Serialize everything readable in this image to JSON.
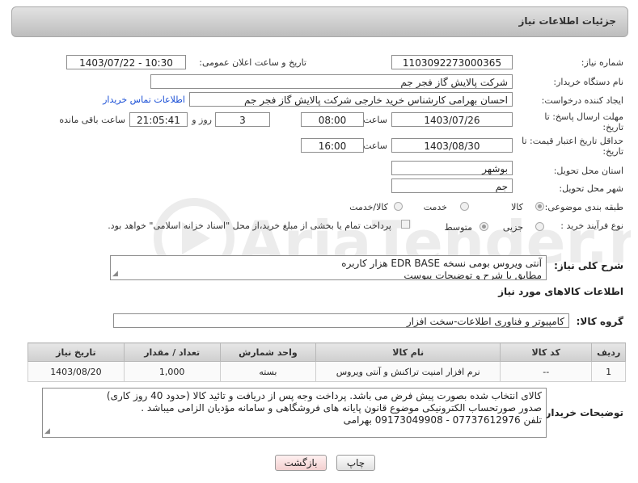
{
  "header": {
    "title": "جزئیات اطلاعات نیاز"
  },
  "form": {
    "need_number_label": "شماره نیاز:",
    "need_number": "1103092273000365",
    "announce_label": "تاریخ و ساعت اعلان عمومی:",
    "announce_value": "1403/07/22 - 10:30",
    "buyer_org_label": "نام دستگاه خریدار:",
    "buyer_org": "شرکت پالایش گاز فجر جم",
    "creator_label": "ایجاد کننده درخواست:",
    "creator": "احسان بهرامی کارشناس خرید خارجی شرکت پالایش گاز فجر جم",
    "contact_link": "اطلاعات تماس خریدار",
    "deadline_label_1": "مهلت ارسال پاسخ: تا",
    "deadline_label_2": "تاریخ:",
    "deadline_date": "1403/07/26",
    "time_label": "ساعت",
    "deadline_time": "08:00",
    "days_value": "3",
    "days_label": "روز و",
    "remaining_time": "21:05:41",
    "remaining_label": "ساعت باقی مانده",
    "validity_label_1": "حداقل تاریخ اعتبار قیمت: تا",
    "validity_label_2": "تاریخ:",
    "validity_date": "1403/08/30",
    "validity_time": "16:00",
    "province_label": "استان محل تحویل:",
    "province": "بوشهر",
    "city_label": "شهر محل تحویل:",
    "city": "جم",
    "category_label": "طبقه بندی موضوعی:",
    "category_options": [
      "کالا",
      "خدمت",
      "کالا/خدمت"
    ],
    "process_label": "نوع فرآیند خرید :",
    "process_options": [
      "جزیی",
      "متوسط"
    ],
    "payment_note": "پرداخت تمام یا بخشی از مبلغ خرید،از محل \"اسناد خزانه اسلامی\" خواهد بود."
  },
  "description": {
    "label": "شرح کلی نیاز:",
    "line1": "آنتی ویروس بومی نسخه EDR BASE  هزار کاربره",
    "line2": "مطابق با شرح و توضیحات پیوست"
  },
  "goods": {
    "section_title": "اطلاعات کالاهای مورد نیاز",
    "group_label": "گروه کالا:",
    "group_value": "کامپیوتر و فناوری اطلاعات-سخت افزار",
    "columns": [
      "ردیف",
      "کد کالا",
      "نام کالا",
      "واحد شمارش",
      "تعداد / مقدار",
      "تاریخ نیاز"
    ],
    "rows": [
      [
        "1",
        "--",
        "نرم افزار امنیت تراکنش و آنتی ویروس",
        "بسته",
        "1,000",
        "1403/08/20"
      ]
    ]
  },
  "buyer_notes": {
    "label": "توضیحات خریدار:",
    "line1": "کالای انتخاب شده بصورت پیش فرض می باشد. پرداخت وجه پس از دریافت و تائید کالا (حدود 40 روز کاری)",
    "line2": "صدور صورتحساب الکترونیکی موضوع قانون پایانه های فروشگاهی و سامانه مؤدیان الزامی میباشد .",
    "line3": "تلفن 07737612976 - 09173049908 بهرامی"
  },
  "buttons": {
    "print": "چاپ",
    "back": "بازگشت"
  },
  "watermark": {
    "text": "AriaTender.net"
  }
}
